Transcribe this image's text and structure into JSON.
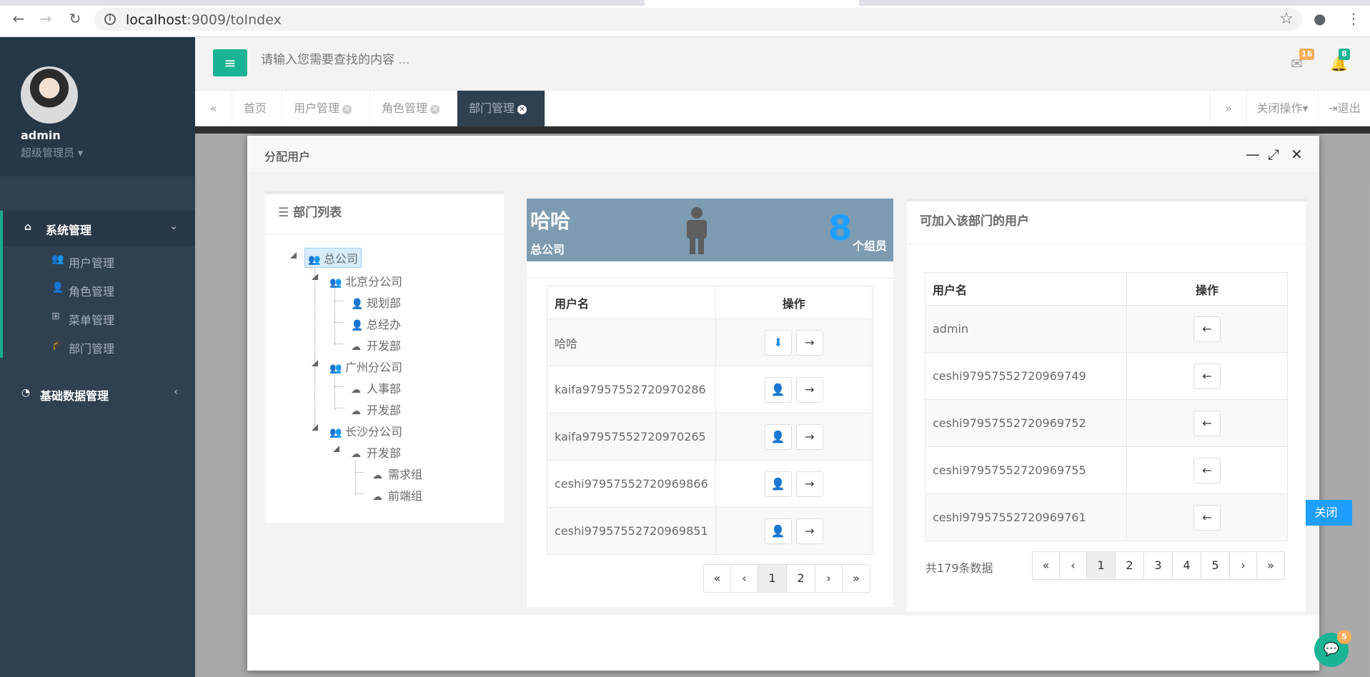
{
  "browser": {
    "url_host": "localhost",
    "url_rest": ":9009/toIndex"
  },
  "sidebar": {
    "username": "admin",
    "role": "超级管理员",
    "groups": [
      {
        "label": "系统管理",
        "icon": "home-icon"
      },
      {
        "label": "基础数据管理",
        "icon": "pie-chart-icon"
      }
    ],
    "items": [
      {
        "label": "用户管理",
        "icon": "users-icon"
      },
      {
        "label": "角色管理",
        "icon": "user-icon"
      },
      {
        "label": "菜单管理",
        "icon": "sitemap-icon"
      },
      {
        "label": "部门管理",
        "icon": "graduation-cap-icon"
      }
    ]
  },
  "header": {
    "search_placeholder": "请输入您需要查找的内容 …",
    "mail_count": "16",
    "bell_count": "8"
  },
  "tabs": {
    "items": [
      "首页",
      "用户管理",
      "角色管理",
      "部门管理"
    ],
    "close_ops": "关闭操作",
    "logout": "退出"
  },
  "modal": {
    "title": "分配用户",
    "close_label": "关闭",
    "tree": {
      "title": "部门列表",
      "nodes": [
        "总公司",
        "北京分公司",
        "规划部",
        "总经办",
        "开发部",
        "广州分公司",
        "人事部",
        "开发部",
        "长沙分公司",
        "开发部",
        "需求组",
        "前端组"
      ]
    },
    "dept": {
      "name": "哈哈",
      "parent": "总公司",
      "count": "8",
      "count_label": "个组员"
    },
    "members": {
      "col_user": "用户名",
      "col_op": "操作",
      "rows": [
        "哈哈",
        "kaifa97957552720970286",
        "kaifa97957552720970265",
        "ceshi97957552720969866",
        "ceshi97957552720969851"
      ],
      "pages": [
        "«",
        "‹",
        "1",
        "2",
        "›",
        "»"
      ]
    },
    "available": {
      "title": "可加入该部门的用户",
      "col_user": "用户名",
      "col_op": "操作",
      "rows": [
        "admin",
        "ceshi97957552720969749",
        "ceshi97957552720969752",
        "ceshi97957552720969755",
        "ceshi97957552720969761"
      ],
      "total": "共179条数据",
      "pages": [
        "«",
        "‹",
        "1",
        "2",
        "3",
        "4",
        "5",
        "›",
        "»"
      ]
    }
  },
  "chat_badge": "5",
  "colors": {
    "accent": "#1ab394",
    "sidebar": "#2f4050",
    "primary": "#1e9fff"
  }
}
